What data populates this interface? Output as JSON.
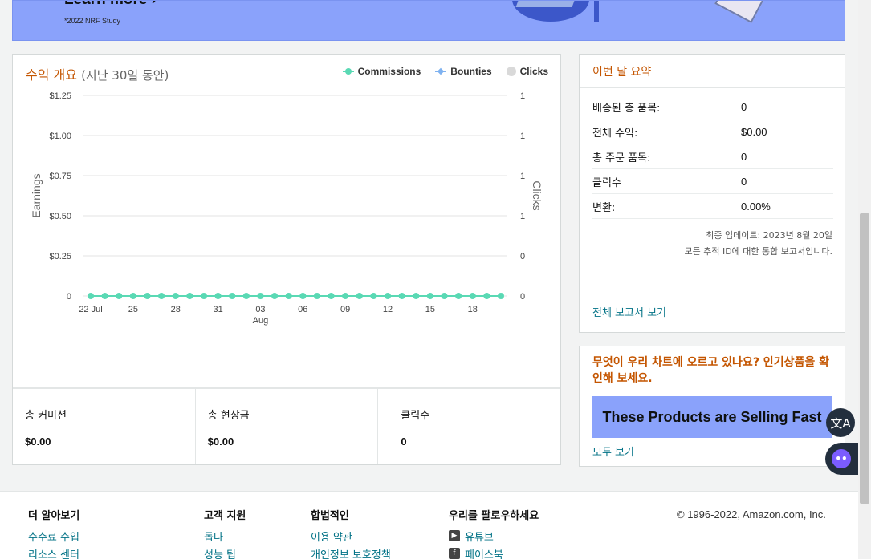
{
  "banner": {
    "learn_more": "Learn more ›",
    "footnote": "*2022 NRF Study"
  },
  "earnings": {
    "title": "수익 개요",
    "subtitle": "(지난 30일 동안)",
    "legend": [
      {
        "label": "Commissions",
        "color": "#5ad9b4"
      },
      {
        "label": "Bounties",
        "color": "#7fb2f0"
      },
      {
        "label": "Clicks",
        "color": "#d9d9d9"
      }
    ],
    "stats": [
      {
        "label": "총 커미션",
        "value": "$0.00"
      },
      {
        "label": "총 현상금",
        "value": "$0.00"
      },
      {
        "label": "클릭수",
        "value": "0"
      }
    ]
  },
  "chart_data": {
    "type": "line",
    "ylabel": "Earnings",
    "y2label": "Clicks",
    "y_ticks": [
      "$1.25",
      "$1.00",
      "$0.75",
      "$0.50",
      "$0.25",
      "0"
    ],
    "y2_ticks": [
      "1",
      "1",
      "1",
      "1",
      "0",
      "0"
    ],
    "ylim": [
      0,
      1.25
    ],
    "x_ticks": [
      "22 Jul",
      "25",
      "28",
      "31",
      "03",
      "06",
      "09",
      "12",
      "15",
      "18"
    ],
    "x_month_label": "Aug",
    "series": [
      {
        "name": "Commissions",
        "color": "#5ad9b4",
        "x": [
          "Jul 22",
          "Jul 23",
          "Jul 24",
          "Jul 25",
          "Jul 26",
          "Jul 27",
          "Jul 28",
          "Jul 29",
          "Jul 30",
          "Jul 31",
          "Aug 01",
          "Aug 02",
          "Aug 03",
          "Aug 04",
          "Aug 05",
          "Aug 06",
          "Aug 07",
          "Aug 08",
          "Aug 09",
          "Aug 10",
          "Aug 11",
          "Aug 12",
          "Aug 13",
          "Aug 14",
          "Aug 15",
          "Aug 16",
          "Aug 17",
          "Aug 18",
          "Aug 19",
          "Aug 20"
        ],
        "values": [
          0,
          0,
          0,
          0,
          0,
          0,
          0,
          0,
          0,
          0,
          0,
          0,
          0,
          0,
          0,
          0,
          0,
          0,
          0,
          0,
          0,
          0,
          0,
          0,
          0,
          0,
          0,
          0,
          0,
          0
        ]
      }
    ],
    "grid": true
  },
  "summary": {
    "title": "이번 달 요약",
    "rows": [
      {
        "label": "배송된 총 품목:",
        "value": "0"
      },
      {
        "label": "전체 수익:",
        "value": "$0.00"
      },
      {
        "label": "총 주문 품목:",
        "value": "0"
      },
      {
        "label": "클릭수",
        "value": "0"
      },
      {
        "label": "변환:",
        "value": "0.00%"
      }
    ],
    "updated": "최종 업데이트: 2023년 8월 20일",
    "note": "모든 추적 ID에 대한 통합 보고서입니다.",
    "link": "전체 보고서 보기"
  },
  "popular": {
    "title": "무엇이 우리 차트에 오르고 있나요? 인기상품을 확인해 보세요.",
    "banner": "These Products are Selling Fast",
    "link": "모두 보기"
  },
  "footer": {
    "cols": [
      {
        "heading": "더 알아보기",
        "links": [
          "수수료 수입",
          "리소스 센터"
        ]
      },
      {
        "heading": "고객 지원",
        "links": [
          "돕다",
          "성능 팁"
        ]
      },
      {
        "heading": "합법적인",
        "links": [
          "이용 약관",
          "개인정보 보호정책"
        ]
      },
      {
        "heading": "우리를 팔로우하세요",
        "links": [
          "유튜브",
          "페이스북"
        ]
      }
    ],
    "copyright": "© 1996-2022, Amazon.com, Inc."
  },
  "icons": {
    "translate": "translate-icon",
    "assistant": "assistant-icon",
    "youtube": "youtube-icon",
    "facebook": "facebook-icon"
  }
}
